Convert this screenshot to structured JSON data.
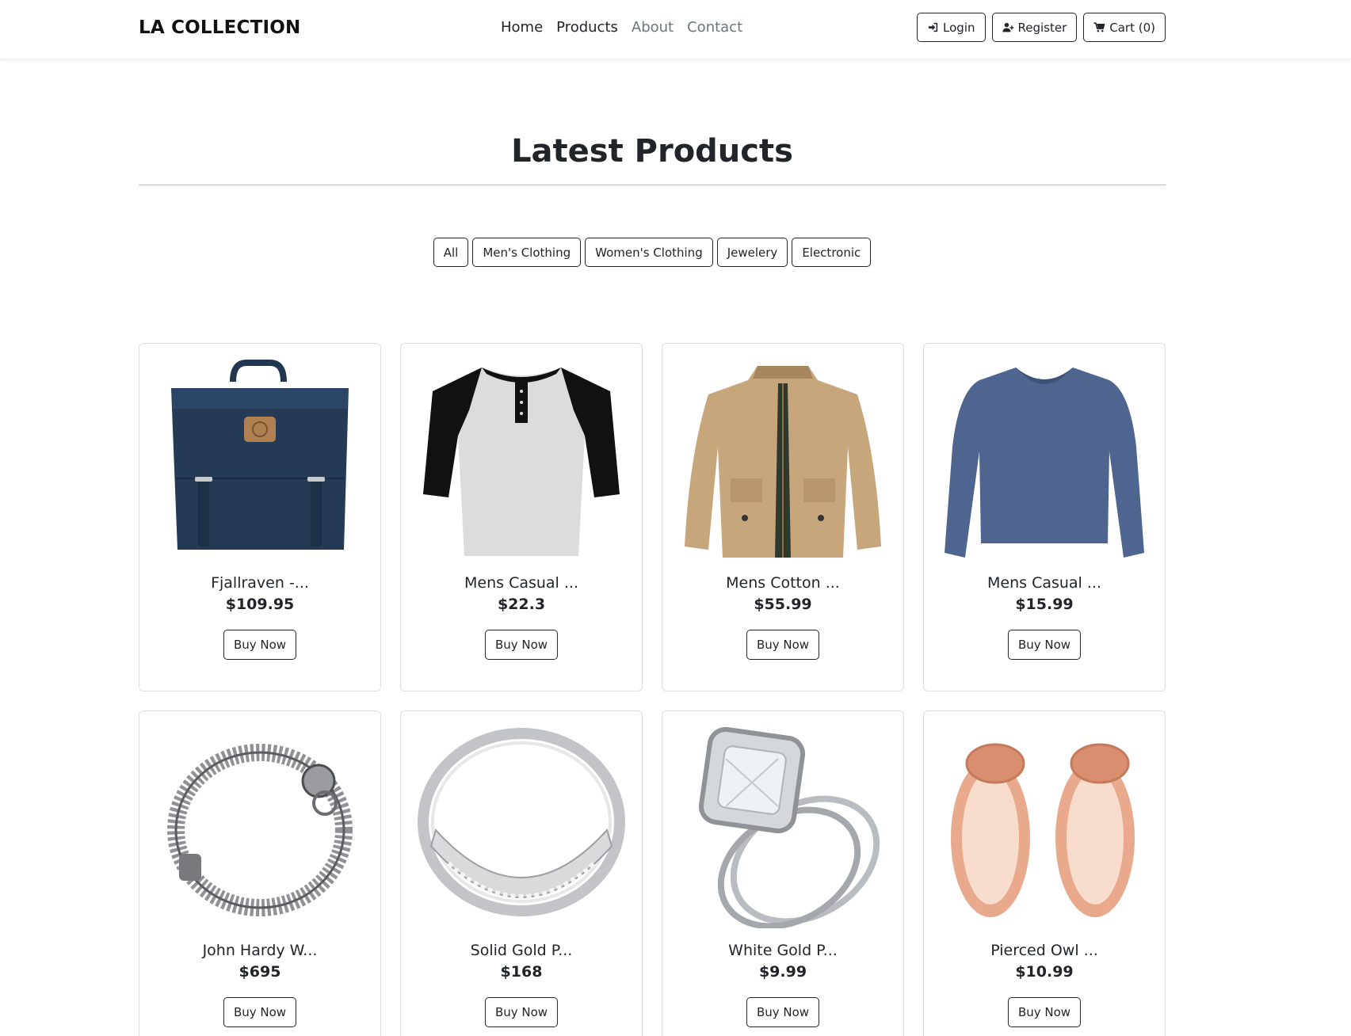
{
  "navbar": {
    "brand": "LA COLLECTION",
    "links": [
      "Home",
      "Products",
      "About",
      "Contact"
    ],
    "login_label": "Login",
    "register_label": "Register",
    "cart_label": "Cart (0)"
  },
  "section": {
    "title": "Latest Products"
  },
  "filters": [
    "All",
    "Men's Clothing",
    "Women's Clothing",
    "Jewelery",
    "Electronic"
  ],
  "products": [
    {
      "name": "Fjallraven -...",
      "price": "$109.95",
      "buy_label": "Buy Now",
      "image": "backpack"
    },
    {
      "name": "Mens Casual ...",
      "price": "$22.3",
      "buy_label": "Buy Now",
      "image": "raglan-tshirt"
    },
    {
      "name": "Mens Cotton ...",
      "price": "$55.99",
      "buy_label": "Buy Now",
      "image": "cotton-jacket"
    },
    {
      "name": "Mens Casual ...",
      "price": "$15.99",
      "buy_label": "Buy Now",
      "image": "longsleeve-shirt"
    },
    {
      "name": "John Hardy W...",
      "price": "$695",
      "buy_label": "Buy Now",
      "image": "dragon-bracelet"
    },
    {
      "name": "Solid Gold P...",
      "price": "$168",
      "buy_label": "Buy Now",
      "image": "silver-band-ring"
    },
    {
      "name": "White Gold P...",
      "price": "$9.99",
      "buy_label": "Buy Now",
      "image": "diamond-ring"
    },
    {
      "name": "Pierced Owl ...",
      "price": "$10.99",
      "buy_label": "Buy Now",
      "image": "rose-gold-plugs"
    }
  ]
}
